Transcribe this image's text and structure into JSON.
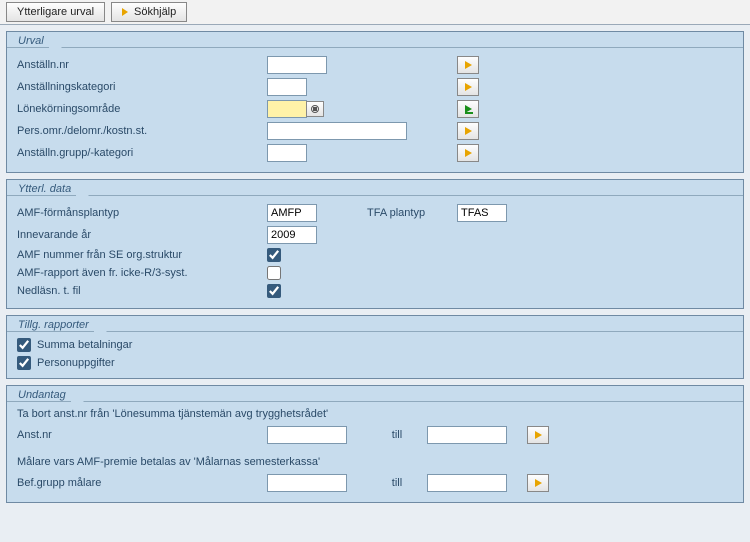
{
  "toolbar": {
    "btn_urval": "Ytterligare urval",
    "btn_sokhjalp": "Sökhjälp"
  },
  "urval": {
    "title": "Urval",
    "anstalln_nr_label": "Anställn.nr",
    "anstalln_nr_value": "",
    "anst_kat_label": "Anställningskategori",
    "anst_kat_value": "",
    "lonekor_label": "Lönekörningsområde",
    "lonekor_value": "",
    "pers_label": "Pers.omr./delomr./kostn.st.",
    "pers_value": "",
    "grupp_label": "Anställn.grupp/-kategori",
    "grupp_value": ""
  },
  "ytterl": {
    "title": "Ytterl. data",
    "amf_plan_label": "AMF-förmånsplantyp",
    "amf_plan_value": "AMFP",
    "tfa_label": "TFA plantyp",
    "tfa_value": "TFAS",
    "innev_label": "Innevarande år",
    "innev_value": "2009",
    "amf_num_label": "AMF nummer från SE org.struktur",
    "amf_num_checked": true,
    "amf_rapp_label": "AMF-rapport även fr. icke-R/3-syst.",
    "amf_rapp_checked": false,
    "nedlasn_label": "Nedläsn. t. fil",
    "nedlasn_checked": true
  },
  "tillg": {
    "title": "Tillg. rapporter",
    "summa_label": "Summa betalningar",
    "summa_checked": true,
    "person_label": "Personuppgifter",
    "person_checked": true
  },
  "undantag": {
    "title": "Undantag",
    "ta_bort_text": "Ta bort anst.nr från 'Lönesumma tjänstemän avg trygghetsrådet'",
    "anst_label": "Anst.nr",
    "anst_from": "",
    "till_label": "till",
    "anst_to": "",
    "malare_text": "Målare vars AMF-premie betalas av 'Målarnas semesterkassa'",
    "bef_label": "Bef.grupp målare",
    "bef_from": "",
    "bef_to": ""
  }
}
